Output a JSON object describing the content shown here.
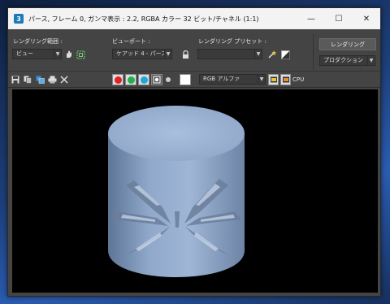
{
  "window": {
    "title": "パース, フレーム 0, ガンマ表示 : 2.2, RGBA カラー 32 ビット/チャネル (1:1)",
    "controls": {
      "minimize": "—",
      "maximize": "☐",
      "close": "✕"
    }
  },
  "settings": {
    "render_area_label": "レンダリング範囲 :",
    "render_area_value": "ビュー",
    "viewport_label": "ビューポート :",
    "viewport_value": "ケアッド 4 - パース",
    "preset_label": "レンダリング プリセット :",
    "preset_value": "",
    "render_button": "レンダリング",
    "mode_value": "プロダクション"
  },
  "channels": {
    "display_value": "RGB アルファ",
    "cpu_label": "CPU",
    "colors": {
      "red": "#e0202a",
      "green": "#22b04b",
      "blue": "#1fa7d8"
    }
  },
  "viewport": {
    "background": "#000000",
    "object_color": "#8ca3c6"
  }
}
